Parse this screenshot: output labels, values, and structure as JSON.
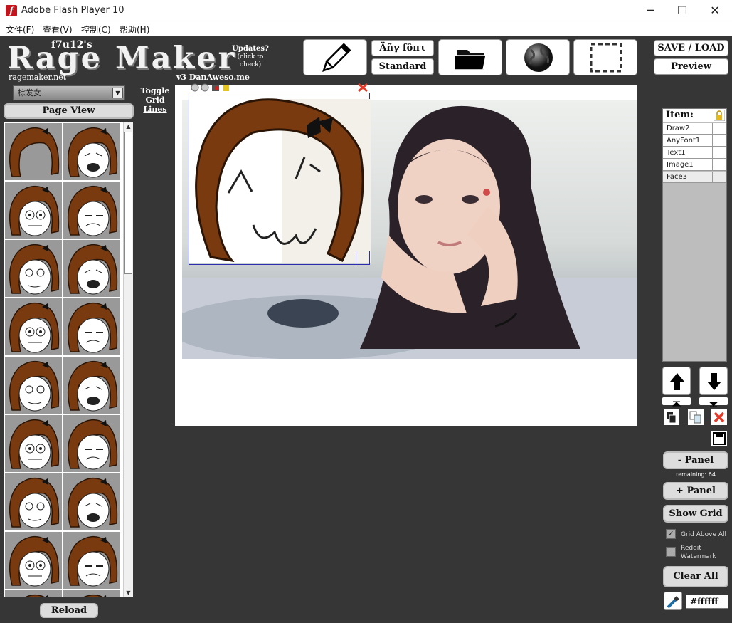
{
  "window": {
    "title": "Adobe Flash Player 10"
  },
  "menu": [
    {
      "label": "文件(F)"
    },
    {
      "label": "查看(V)"
    },
    {
      "label": "控制(C)"
    },
    {
      "label": "帮助(H)"
    }
  ],
  "header": {
    "byline": "f7u12's",
    "logo": "Rage Maker",
    "site": "ragemaker.net",
    "version": "v3  DanAweso.me",
    "updates_title": "Updates?",
    "updates_sub": "(click to check)"
  },
  "toolbar": {
    "font_fancy_label": "Äñγ fôπτ",
    "font_standard_label": "Standard",
    "save_load_label": "SAVE / LOAD",
    "preview_label": "Preview"
  },
  "left_panel": {
    "category_selected": "棕发女",
    "page_view_label": "Page View",
    "reload_label": "Reload",
    "toggle_grid": [
      "Toggle",
      "Grid",
      "Lines"
    ]
  },
  "items_panel": {
    "header": "Item:",
    "items": [
      {
        "label": "Draw2"
      },
      {
        "label": "AnyFont1"
      },
      {
        "label": "Text1"
      },
      {
        "label": "Image1"
      },
      {
        "label": "Face3"
      }
    ]
  },
  "controls": {
    "minus_panel": "- Panel",
    "remaining": "remaining: 64",
    "plus_panel": "+ Panel",
    "show_grid": "Show Grid",
    "grid_above_all": "Grid Above All",
    "reddit_watermark": "Reddit Watermark",
    "clear_all": "Clear All",
    "color_value": "#ffffff"
  },
  "colors": {
    "stage_bg": "#363636",
    "hair": "#7a3a0f",
    "selection": "#2d2db0"
  }
}
